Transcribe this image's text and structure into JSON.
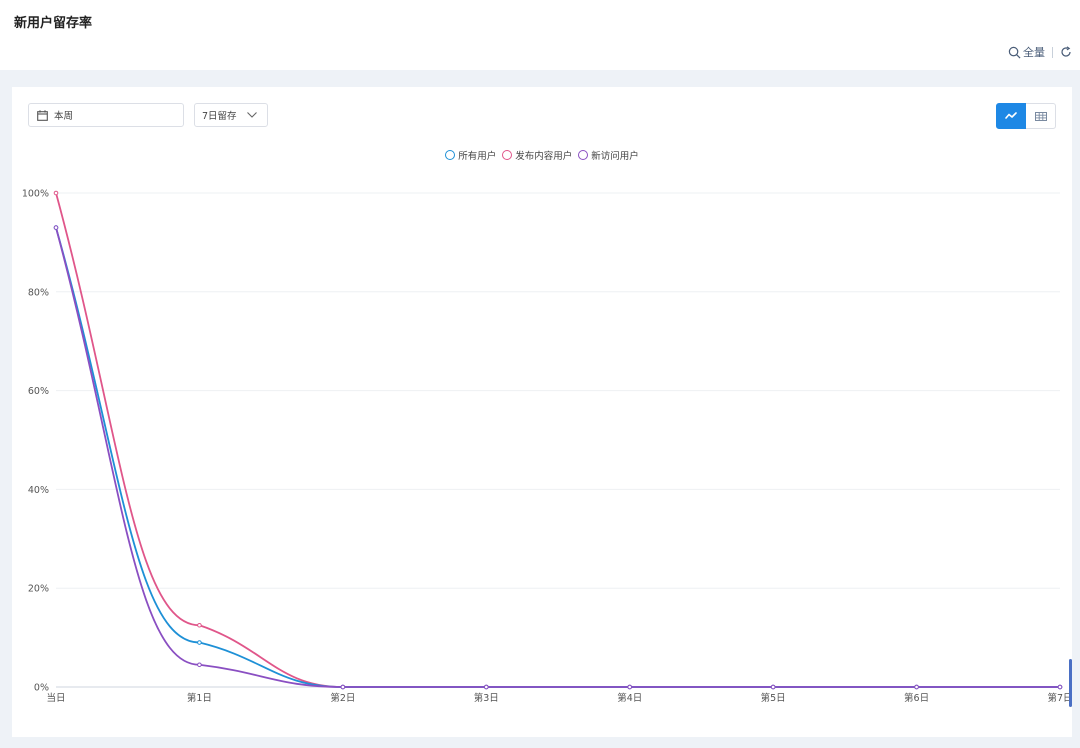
{
  "page": {
    "title": "新用户留存率"
  },
  "toolbar": {
    "scope_label": "全量"
  },
  "filters": {
    "date_range": "本周",
    "retention_period": "7日留存"
  },
  "chart_data": {
    "type": "line",
    "categories": [
      "当日",
      "第1日",
      "第2日",
      "第3日",
      "第4日",
      "第5日",
      "第6日",
      "第7日"
    ],
    "y_ticks": [
      "0%",
      "20%",
      "40%",
      "60%",
      "80%",
      "100%"
    ],
    "ylim": [
      0,
      100
    ],
    "smooth": true,
    "legend_position": "top-center",
    "grid": true,
    "series": [
      {
        "name": "所有用户",
        "color": "#1e90d6",
        "values": [
          93,
          9,
          0,
          0,
          0,
          0,
          0,
          0
        ]
      },
      {
        "name": "发布内容用户",
        "color": "#e0568a",
        "values": [
          100,
          12.5,
          0,
          0,
          0,
          0,
          0,
          0
        ]
      },
      {
        "name": "新访问用户",
        "color": "#8a4fc2",
        "values": [
          93,
          4.5,
          0,
          0,
          0,
          0,
          0,
          0
        ]
      }
    ]
  }
}
